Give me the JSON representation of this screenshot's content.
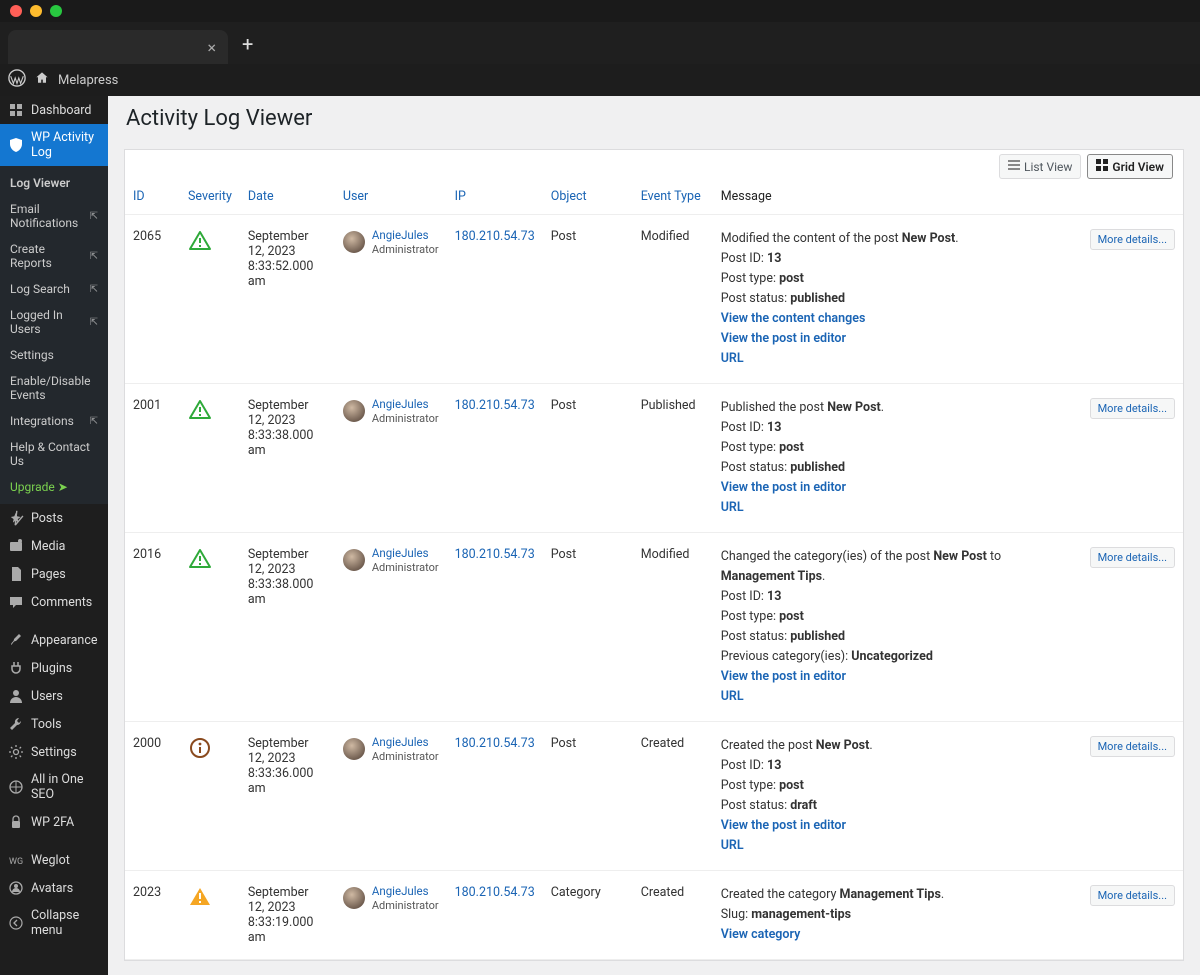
{
  "site_name": "Melapress",
  "page_title": "Activity Log Viewer",
  "view_toggle": {
    "list": "List View",
    "grid": "Grid View"
  },
  "sidebar": {
    "main": [
      {
        "icon": "dashboard",
        "label": "Dashboard"
      },
      {
        "icon": "shield",
        "label": "WP Activity Log",
        "active": true
      }
    ],
    "submenu": [
      {
        "label": "Log Viewer",
        "bold": true
      },
      {
        "label": "Email Notifications",
        "ext": true
      },
      {
        "label": "Create Reports",
        "ext": true
      },
      {
        "label": "Log Search",
        "ext": true
      },
      {
        "label": "Logged In Users",
        "ext": true
      },
      {
        "label": "Settings"
      },
      {
        "label": "Enable/Disable Events"
      },
      {
        "label": "Integrations",
        "ext": true
      },
      {
        "label": "Help & Contact Us"
      },
      {
        "label": "Upgrade  ➤",
        "upgrade": true
      }
    ],
    "rest": [
      {
        "icon": "pin",
        "label": "Posts"
      },
      {
        "icon": "media",
        "label": "Media"
      },
      {
        "icon": "page",
        "label": "Pages"
      },
      {
        "icon": "comment",
        "label": "Comments"
      },
      {
        "sep": true
      },
      {
        "icon": "brush",
        "label": "Appearance"
      },
      {
        "icon": "plug",
        "label": "Plugins"
      },
      {
        "icon": "user",
        "label": "Users"
      },
      {
        "icon": "tool",
        "label": "Tools"
      },
      {
        "icon": "gear",
        "label": "Settings"
      },
      {
        "icon": "seo",
        "label": "All in One SEO"
      },
      {
        "icon": "lock",
        "label": "WP 2FA"
      },
      {
        "sep": true
      },
      {
        "icon": "weglot",
        "label": "Weglot"
      },
      {
        "icon": "avatar",
        "label": "Avatars"
      },
      {
        "icon": "collapse",
        "label": "Collapse menu"
      }
    ]
  },
  "columns": {
    "id": "ID",
    "severity": "Severity",
    "date": "Date",
    "user": "User",
    "ip": "IP",
    "object": "Object",
    "event_type": "Event Type",
    "message": "Message"
  },
  "details_label": "More details...",
  "rows": [
    {
      "id": "2065",
      "severity": "warn-green",
      "date": "September 12, 2023",
      "time": "8:33:52.000 am",
      "user_name": "AngieJules",
      "user_role": "Administrator",
      "ip": "180.210.54.73",
      "object": "Post",
      "event_type": "Modified",
      "message": [
        {
          "t": "Modified the content of the post "
        },
        {
          "b": "New Post"
        },
        {
          "t": "."
        },
        {
          "br": true
        },
        {
          "t": "Post ID: "
        },
        {
          "b": "13"
        },
        {
          "br": true
        },
        {
          "t": "Post type: "
        },
        {
          "b": "post"
        },
        {
          "br": true
        },
        {
          "t": "Post status: "
        },
        {
          "b": "published"
        },
        {
          "br": true
        },
        {
          "a": "View the content changes"
        },
        {
          "br": true
        },
        {
          "a": "View the post in editor"
        },
        {
          "br": true
        },
        {
          "a": "URL"
        }
      ]
    },
    {
      "id": "2001",
      "severity": "warn-green",
      "date": "September 12, 2023",
      "time": "8:33:38.000 am",
      "user_name": "AngieJules",
      "user_role": "Administrator",
      "ip": "180.210.54.73",
      "object": "Post",
      "event_type": "Published",
      "message": [
        {
          "t": "Published the post "
        },
        {
          "b": "New Post"
        },
        {
          "t": "."
        },
        {
          "br": true
        },
        {
          "t": "Post ID: "
        },
        {
          "b": "13"
        },
        {
          "br": true
        },
        {
          "t": "Post type: "
        },
        {
          "b": "post"
        },
        {
          "br": true
        },
        {
          "t": "Post status: "
        },
        {
          "b": "published"
        },
        {
          "br": true
        },
        {
          "a": "View the post in editor"
        },
        {
          "br": true
        },
        {
          "a": "URL"
        }
      ]
    },
    {
      "id": "2016",
      "severity": "warn-green",
      "date": "September 12, 2023",
      "time": "8:33:38.000 am",
      "user_name": "AngieJules",
      "user_role": "Administrator",
      "ip": "180.210.54.73",
      "object": "Post",
      "event_type": "Modified",
      "message": [
        {
          "t": "Changed the category(ies) of the post "
        },
        {
          "b": "New Post"
        },
        {
          "t": " to "
        },
        {
          "b": "Management Tips"
        },
        {
          "t": "."
        },
        {
          "br": true
        },
        {
          "t": "Post ID: "
        },
        {
          "b": "13"
        },
        {
          "br": true
        },
        {
          "t": "Post type: "
        },
        {
          "b": "post"
        },
        {
          "br": true
        },
        {
          "t": "Post status: "
        },
        {
          "b": "published"
        },
        {
          "br": true
        },
        {
          "t": "Previous category(ies): "
        },
        {
          "b": "Uncategorized"
        },
        {
          "br": true
        },
        {
          "a": "View the post in editor"
        },
        {
          "br": true
        },
        {
          "a": "URL"
        }
      ]
    },
    {
      "id": "2000",
      "severity": "info",
      "date": "September 12, 2023",
      "time": "8:33:36.000 am",
      "user_name": "AngieJules",
      "user_role": "Administrator",
      "ip": "180.210.54.73",
      "object": "Post",
      "event_type": "Created",
      "message": [
        {
          "t": "Created the post "
        },
        {
          "b": "New Post"
        },
        {
          "t": "."
        },
        {
          "br": true
        },
        {
          "t": "Post ID: "
        },
        {
          "b": "13"
        },
        {
          "br": true
        },
        {
          "t": "Post type: "
        },
        {
          "b": "post"
        },
        {
          "br": true
        },
        {
          "t": "Post status: "
        },
        {
          "b": "draft"
        },
        {
          "br": true
        },
        {
          "a": "View the post in editor"
        },
        {
          "br": true
        },
        {
          "a": "URL"
        }
      ]
    },
    {
      "id": "2023",
      "severity": "warn-orange",
      "date": "September 12, 2023",
      "time": "8:33:19.000 am",
      "user_name": "AngieJules",
      "user_role": "Administrator",
      "ip": "180.210.54.73",
      "object": "Category",
      "event_type": "Created",
      "message": [
        {
          "t": "Created the category "
        },
        {
          "b": "Management Tips"
        },
        {
          "t": "."
        },
        {
          "br": true
        },
        {
          "t": "Slug: "
        },
        {
          "b": "management-tips"
        },
        {
          "br": true
        },
        {
          "a": "View category"
        }
      ]
    }
  ]
}
